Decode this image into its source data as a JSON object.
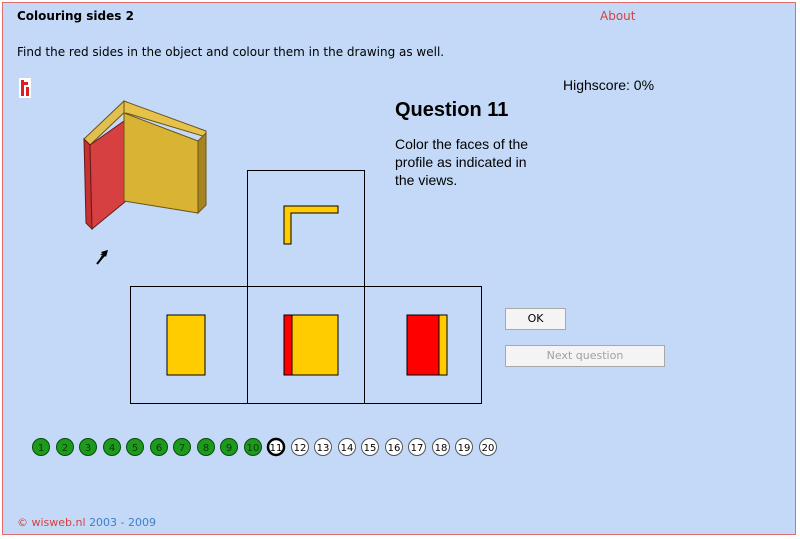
{
  "app": {
    "title": "Colouring sides 2",
    "about": "About",
    "instruction": "Find the red sides in the object and colour them in the drawing as well.",
    "highscore": "Highscore: 0%"
  },
  "question": {
    "title": "Question 11",
    "text": "Color the faces of the profile as indicated in the views."
  },
  "views": [
    "top view",
    "left view",
    "front view",
    "right view"
  ],
  "buttons": {
    "ok": "OK",
    "next": "Next question",
    "next_enabled": false
  },
  "progress": {
    "current": 11,
    "completed": [
      1,
      2,
      3,
      4,
      5,
      6,
      7,
      8,
      9,
      10
    ],
    "labels": [
      "1",
      "2",
      "3",
      "4",
      "5",
      "6",
      "7",
      "8",
      "9",
      "10",
      "11",
      "12",
      "13",
      "14",
      "15",
      "16",
      "17",
      "18",
      "19",
      "20"
    ]
  },
  "footer": {
    "copyright": "© wisweb.nl",
    "years": "2003 - 2009"
  },
  "colors": {
    "background": "#c3d9f7",
    "red_face": "#ff0000",
    "yellow_face": "#ffcc00",
    "model_yellow": "#d9b334",
    "model_red": "#d83a3a",
    "completed_circle": "#1c9a1c",
    "accent_text": "#d84040"
  }
}
